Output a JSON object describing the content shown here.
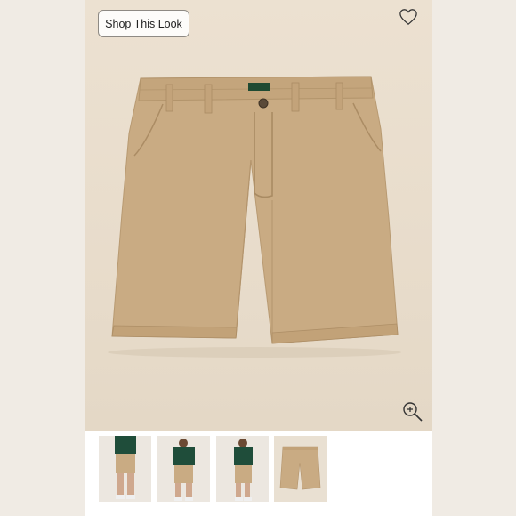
{
  "viewer": {
    "shop_button_label": "Shop This Look",
    "heart_icon": "heart-outline-icon",
    "zoom_icon": "zoom-in-icon",
    "product_color": "#c9ab83"
  },
  "thumbnails": [
    {
      "view": "model-front",
      "active": false
    },
    {
      "view": "model-front-alt",
      "active": false
    },
    {
      "view": "model-side",
      "active": false
    },
    {
      "view": "product-flat",
      "active": true
    }
  ],
  "colors": {
    "background": "#ede3d4",
    "active_indicator": "#1a1a1a"
  }
}
